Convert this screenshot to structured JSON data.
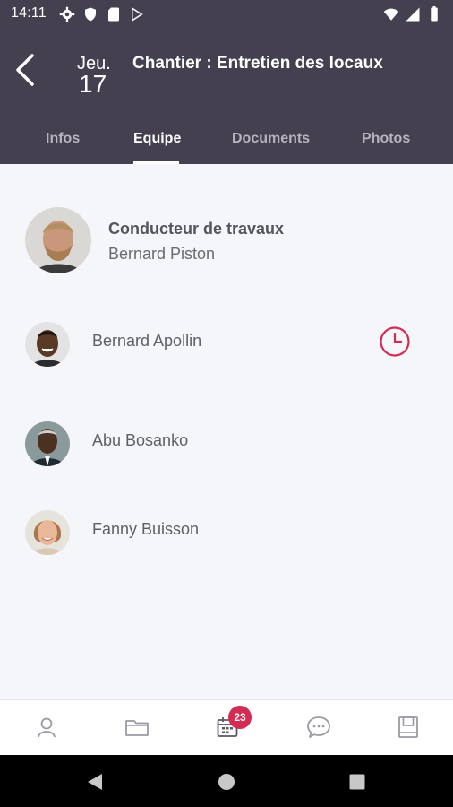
{
  "status_bar": {
    "time": "14:11",
    "left_icons": [
      "settings-icon",
      "shield-icon",
      "sd-card-icon",
      "play-store-icon"
    ],
    "right_icons": [
      "wifi-icon",
      "signal-icon",
      "battery-icon"
    ]
  },
  "header": {
    "day_of_week": "Jeu.",
    "day_number": "17",
    "title": "Chantier : Entretien des locaux",
    "background": "#45404f"
  },
  "tabs": [
    {
      "label": "Infos",
      "active": false
    },
    {
      "label": "Equipe",
      "active": true
    },
    {
      "label": "Documents",
      "active": false
    },
    {
      "label": "Photos",
      "active": false
    }
  ],
  "team": {
    "lead": {
      "role": "Conducteur de travaux",
      "name": "Bernard Piston"
    },
    "members": [
      {
        "name": "Bernard Apollin",
        "has_clock": true
      },
      {
        "name": "Abu Bosanko",
        "has_clock": false
      },
      {
        "name": "Fanny Buisson",
        "has_clock": false
      }
    ]
  },
  "bottom_nav": {
    "items": [
      "profile-icon",
      "folder-icon",
      "calendar-icon",
      "chat-icon",
      "save-icon"
    ],
    "calendar_badge": "23",
    "badge_color": "#d42b52"
  },
  "accent_color": "#d42b52"
}
